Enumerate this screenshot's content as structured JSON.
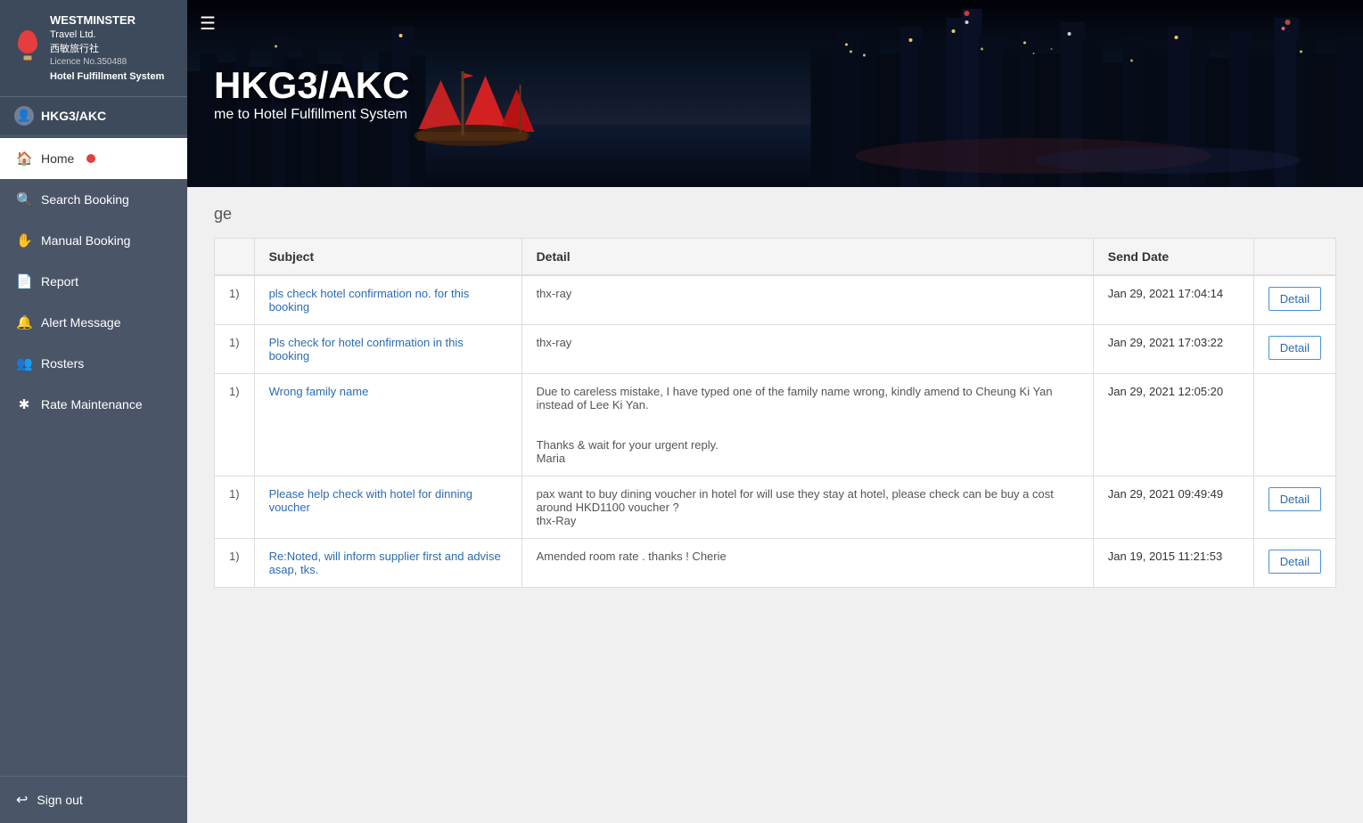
{
  "sidebar": {
    "company": "WESTMINSTER",
    "company_line2": "Travel Ltd.",
    "chinese": "西敏旅行社",
    "licence": "Licence No.350488",
    "system": "Hotel Fulfillment System",
    "user": "HKG3/AKC",
    "nav_items": [
      {
        "id": "home",
        "label": "Home",
        "icon": "🏠",
        "active": true,
        "badge": true
      },
      {
        "id": "search-booking",
        "label": "Search Booking",
        "icon": "🔍",
        "active": false,
        "badge": false
      },
      {
        "id": "manual-booking",
        "label": "Manual Booking",
        "icon": "✋",
        "active": false,
        "badge": false
      },
      {
        "id": "report",
        "label": "Report",
        "icon": "📄",
        "active": false,
        "badge": false
      },
      {
        "id": "alert-message",
        "label": "Alert Message",
        "icon": "🔔",
        "active": false,
        "badge": false
      },
      {
        "id": "rosters",
        "label": "Rosters",
        "icon": "👥",
        "active": false,
        "badge": false
      },
      {
        "id": "rate-maintenance",
        "label": "Rate Maintenance",
        "icon": "✱",
        "active": false,
        "badge": false
      }
    ],
    "signout_label": "Sign out",
    "signout_icon": "↩"
  },
  "banner": {
    "title": "HKG3/AKC",
    "subtitle": "me to Hotel Fulfillment System",
    "hamburger": "☰"
  },
  "main": {
    "subtitle": "ge",
    "table": {
      "headers": [
        "",
        "Subject",
        "Detail",
        "Send Date",
        ""
      ],
      "rows": [
        {
          "id": "1)",
          "subject": "pls check hotel confirmation no. for this booking",
          "detail": "thx-ray",
          "send_date": "Jan 29, 2021 17:04:14",
          "has_detail": true
        },
        {
          "id": "1)",
          "subject": "Pls check for hotel confirmation in this booking",
          "detail": "thx-ray",
          "send_date": "Jan 29, 2021 17:03:22",
          "has_detail": true
        },
        {
          "id": "1)",
          "subject": "Wrong family name",
          "detail": "Due to careless mistake, I have typed one of the family name wrong, kindly amend to Cheung Ki Yan instead of Lee Ki Yan.\n\n\nThanks & wait for your urgent reply.\nMaria",
          "send_date": "Jan 29, 2021 12:05:20",
          "has_detail": false
        },
        {
          "id": "1)",
          "subject": "Please help check with hotel for dinning voucher",
          "detail": "pax want to buy dining voucher in hotel for will use they stay at hotel, please check can be buy a cost around HKD1100 voucher ?\nthx-Ray",
          "send_date": "Jan 29, 2021 09:49:49",
          "has_detail": true
        },
        {
          "id": "1)",
          "subject": "Re:Noted, will inform supplier first and advise asap, tks.",
          "detail": "Amended room rate . thanks ! Cherie",
          "send_date": "Jan 19, 2015 11:21:53",
          "has_detail": true
        }
      ],
      "detail_btn_label": "Detail"
    }
  }
}
